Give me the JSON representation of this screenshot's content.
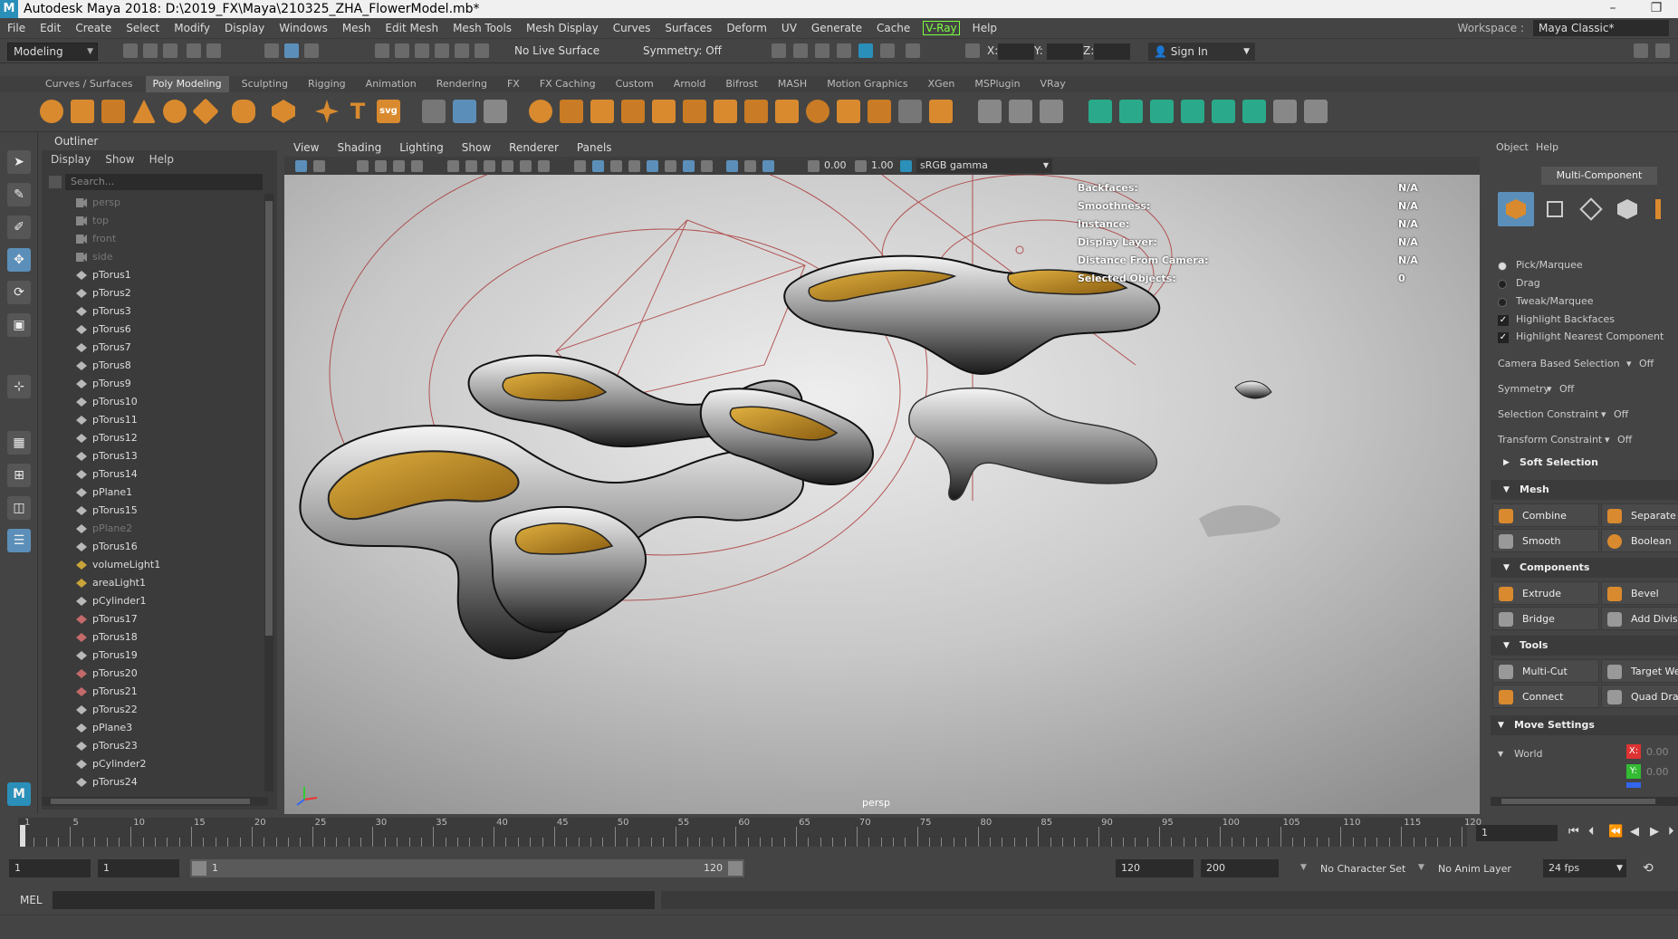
{
  "window": {
    "title": "Autodesk Maya 2018: D:\\2019_FX\\Maya\\210325_ZHA_FlowerModel.mb*",
    "minimize": "–",
    "maximize": "❐"
  },
  "menubar": {
    "items": [
      "File",
      "Edit",
      "Create",
      "Select",
      "Modify",
      "Display",
      "Windows",
      "Mesh",
      "Edit Mesh",
      "Mesh Tools",
      "Mesh Display",
      "Curves",
      "Surfaces",
      "Deform",
      "UV",
      "Generate",
      "Cache"
    ],
    "vray": "V-Ray",
    "help": "Help",
    "workspace_label": "Workspace :",
    "workspace_value": "Maya Classic*"
  },
  "statusline": {
    "mode": "Modeling",
    "live_surface": "No Live Surface",
    "symmetry": "Symmetry: Off",
    "x_label": "X:",
    "y_label": "Y:",
    "z_label": "Z:",
    "sign_in": "Sign In"
  },
  "shelf": {
    "tabs": [
      "Curves / Surfaces",
      "Poly Modeling",
      "Sculpting",
      "Rigging",
      "Animation",
      "Rendering",
      "FX",
      "FX Caching",
      "Custom",
      "Arnold",
      "Bifrost",
      "MASH",
      "Motion Graphics",
      "XGen",
      "MSPlugin",
      "VRay"
    ],
    "active_tab": "Poly Modeling",
    "text_icon": "T",
    "svg_icon": "svg"
  },
  "outliner": {
    "title": "Outliner",
    "menu": [
      "Display",
      "Show",
      "Help"
    ],
    "search_placeholder": "Search...",
    "items": [
      {
        "name": "persp",
        "type": "camera",
        "dim": true
      },
      {
        "name": "top",
        "type": "camera",
        "dim": true
      },
      {
        "name": "front",
        "type": "camera",
        "dim": true
      },
      {
        "name": "side",
        "type": "camera",
        "dim": true
      },
      {
        "name": "pTorus1",
        "type": "mesh"
      },
      {
        "name": "pTorus2",
        "type": "mesh"
      },
      {
        "name": "pTorus3",
        "type": "mesh"
      },
      {
        "name": "pTorus6",
        "type": "mesh"
      },
      {
        "name": "pTorus7",
        "type": "mesh"
      },
      {
        "name": "pTorus8",
        "type": "mesh"
      },
      {
        "name": "pTorus9",
        "type": "mesh"
      },
      {
        "name": "pTorus10",
        "type": "mesh"
      },
      {
        "name": "pTorus11",
        "type": "mesh"
      },
      {
        "name": "pTorus12",
        "type": "mesh"
      },
      {
        "name": "pTorus13",
        "type": "mesh"
      },
      {
        "name": "pTorus14",
        "type": "mesh"
      },
      {
        "name": "pPlane1",
        "type": "mesh"
      },
      {
        "name": "pTorus15",
        "type": "mesh"
      },
      {
        "name": "pPlane2",
        "type": "mesh",
        "dim": true
      },
      {
        "name": "pTorus16",
        "type": "mesh"
      },
      {
        "name": "volumeLight1",
        "type": "light"
      },
      {
        "name": "areaLight1",
        "type": "light"
      },
      {
        "name": "pCylinder1",
        "type": "mesh"
      },
      {
        "name": "pTorus17",
        "type": "deformed"
      },
      {
        "name": "pTorus18",
        "type": "deformed"
      },
      {
        "name": "pTorus19",
        "type": "mesh"
      },
      {
        "name": "pTorus20",
        "type": "deformed"
      },
      {
        "name": "pTorus21",
        "type": "deformed"
      },
      {
        "name": "pTorus22",
        "type": "mesh"
      },
      {
        "name": "pPlane3",
        "type": "mesh"
      },
      {
        "name": "pTorus23",
        "type": "mesh"
      },
      {
        "name": "pCylinder2",
        "type": "mesh"
      },
      {
        "name": "pTorus24",
        "type": "mesh"
      }
    ]
  },
  "viewport": {
    "menu": [
      "View",
      "Shading",
      "Lighting",
      "Show",
      "Renderer",
      "Panels"
    ],
    "exposure": "0.00",
    "gamma": "1.00",
    "colorspace": "sRGB gamma",
    "camera": "persp",
    "hud": [
      {
        "label": "Backfaces:",
        "value": "N/A"
      },
      {
        "label": "Smoothness:",
        "value": "N/A"
      },
      {
        "label": "Instance:",
        "value": "N/A"
      },
      {
        "label": "Display Layer:",
        "value": "N/A"
      },
      {
        "label": "Distance From Camera:",
        "value": "N/A"
      },
      {
        "label": "Selected Objects:",
        "value": "0"
      }
    ]
  },
  "modeling_toolkit": {
    "menu": [
      "Object",
      "Help"
    ],
    "mode_label": "Multi-Component",
    "pick_marquee": "Pick/Marquee",
    "drag": "Drag",
    "tweak_marquee": "Tweak/Marquee",
    "highlight_backfaces": "Highlight Backfaces",
    "highlight_nearest": "Highlight Nearest Component",
    "camera_based_selection": "Camera Based Selection",
    "camera_based_value": "Off",
    "symmetry": "Symmetry",
    "symmetry_value": "Off",
    "selection_constraint": "Selection Constraint",
    "selection_constraint_value": "Off",
    "transform_constraint": "Transform Constraint",
    "transform_constraint_value": "Off",
    "soft_selection": "Soft Selection",
    "mesh_section": "Mesh",
    "combine": "Combine",
    "separate": "Separate",
    "smooth": "Smooth",
    "boolean": "Boolean",
    "components_section": "Components",
    "extrude": "Extrude",
    "bevel": "Bevel",
    "bridge": "Bridge",
    "add_divisions": "Add Divisi",
    "tools_section": "Tools",
    "multi_cut": "Multi-Cut",
    "target_weld": "Target We",
    "connect": "Connect",
    "quad_draw": "Quad Drav",
    "move_settings": "Move Settings",
    "world": "World",
    "x_label": "X:",
    "y_label": "Y:",
    "x_value": "0.00",
    "y_value": "0.00"
  },
  "timeline": {
    "labels": [
      1,
      5,
      10,
      15,
      20,
      25,
      30,
      35,
      40,
      45,
      50,
      55,
      60,
      65,
      70,
      75,
      80,
      85,
      90,
      95,
      100,
      105,
      110,
      115,
      120
    ],
    "current_frame": "1"
  },
  "range": {
    "start": "1",
    "playback_start": "1",
    "bar_start": "1",
    "bar_end": "120",
    "playback_end": "120",
    "end": "200",
    "character_set": "No Character Set",
    "anim_layer": "No Anim Layer",
    "fps": "24 fps"
  },
  "cmdline": {
    "label": "MEL"
  },
  "colors": {
    "accent": "#5b8fb9",
    "orange": "#d98a2e",
    "gold": "#c8961e",
    "vray": "#7cff40"
  }
}
